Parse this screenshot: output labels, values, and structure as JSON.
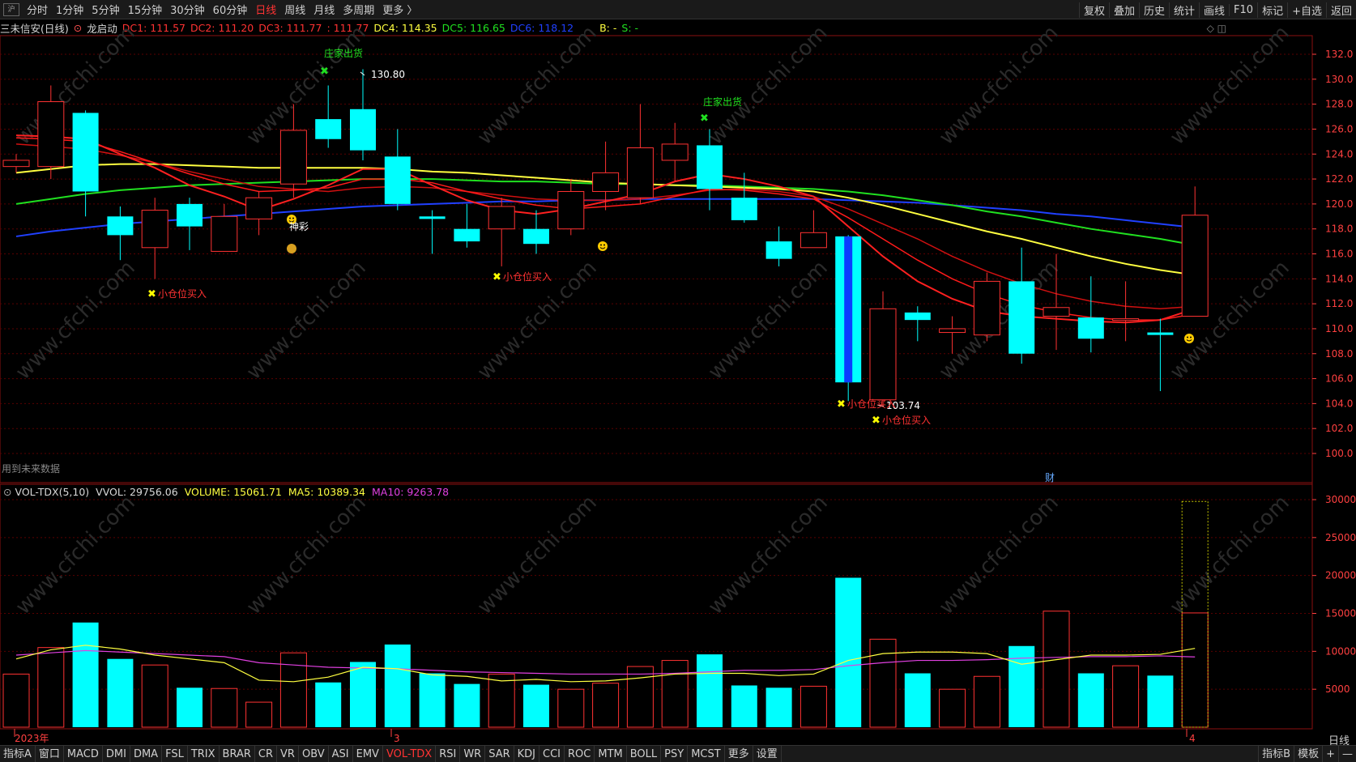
{
  "topbar": {
    "logo": "沪",
    "periods": [
      "分时",
      "1分钟",
      "5分钟",
      "15分钟",
      "30分钟",
      "60分钟",
      "日线",
      "周线",
      "月线",
      "多周期",
      "更多 〉"
    ],
    "active_period": "日线",
    "tools": [
      "复权",
      "叠加",
      "历史",
      "统计",
      "画线",
      "F10",
      "标记",
      "+自选",
      "返回"
    ]
  },
  "info": {
    "stock": "三未信安(日线)",
    "indicator": "龙启动",
    "dc1": "DC1: 111.57",
    "dc2": "DC2: 111.20",
    "dc3": "DC3: 111.77",
    "dc3b": ": 111.77",
    "dc4": "DC4: 114.35",
    "dc5": "DC5: 116.65",
    "dc6": "DC6: 118.12",
    "b": "B: -",
    "s": "S: -",
    "future": "用到未来数据"
  },
  "vol_info": {
    "name": "VOL-TDX(5,10)",
    "vvol": "VVOL: 29756.06",
    "volume": "VOLUME: 15061.71",
    "ma5": "MA5: 10389.34",
    "ma10": "MA10: 9263.78"
  },
  "colors": {
    "up": "#ff3232",
    "down": "#00ffff",
    "ma_red": "#ff2020",
    "ma_yellow": "#ffff40",
    "ma_green": "#20e020",
    "ma_blue": "#2040ff",
    "ma_magenta": "#e040e0",
    "axis": "#ff4040"
  },
  "chart_data": {
    "type": "candlestick",
    "price_ticks": [
      "132.0",
      "130.0",
      "128.0",
      "126.0",
      "124.0",
      "122.0",
      "120.0",
      "118.0",
      "116.0",
      "114.0",
      "112.0",
      "110.0",
      "108.0",
      "106.0",
      "104.0",
      "102.0",
      "100.0"
    ],
    "volume_ticks": [
      "30000",
      "25000",
      "20000",
      "15000",
      "10000",
      "5000"
    ],
    "date_labels": [
      "2023年",
      "3",
      "4"
    ],
    "annotations": {
      "sell1": "庄家出货",
      "sell2": "庄家出货",
      "buy1": "小仓位买入",
      "buy2": "小仓位买入",
      "buy3": "小仓位买入",
      "buy4": "小仓位买入",
      "shencai": "神彩",
      "high": "130.80",
      "low": "103.74",
      "cai": "财"
    },
    "candles": [
      {
        "o": 123.0,
        "h": 124.0,
        "l": 122.5,
        "c": 123.5,
        "v": 7000
      },
      {
        "o": 123.0,
        "h": 129.5,
        "l": 122.0,
        "c": 128.2,
        "v": 10500
      },
      {
        "o": 127.3,
        "h": 127.5,
        "l": 119.0,
        "c": 121.0,
        "v": 13800
      },
      {
        "o": 119.0,
        "h": 119.8,
        "l": 115.5,
        "c": 117.5,
        "v": 9000
      },
      {
        "o": 116.5,
        "h": 120.5,
        "l": 114.0,
        "c": 119.5,
        "v": 8200
      },
      {
        "o": 120.0,
        "h": 120.5,
        "l": 116.3,
        "c": 118.2,
        "v": 5200
      },
      {
        "o": 116.2,
        "h": 120.0,
        "l": 116.2,
        "c": 119.0,
        "v": 5100
      },
      {
        "o": 118.8,
        "h": 121.0,
        "l": 117.5,
        "c": 120.5,
        "v": 3300
      },
      {
        "o": 121.6,
        "h": 128.0,
        "l": 120.5,
        "c": 125.9,
        "v": 9800
      },
      {
        "o": 126.8,
        "h": 129.5,
        "l": 124.5,
        "c": 125.2,
        "v": 5900
      },
      {
        "o": 127.6,
        "h": 130.8,
        "l": 123.5,
        "c": 124.3,
        "v": 8600
      },
      {
        "o": 123.8,
        "h": 126.0,
        "l": 119.5,
        "c": 120.0,
        "v": 10900
      },
      {
        "o": 119.0,
        "h": 119.5,
        "l": 116.0,
        "c": 118.8,
        "v": 7100
      },
      {
        "o": 118.0,
        "h": 120.0,
        "l": 116.5,
        "c": 117.0,
        "v": 5700
      },
      {
        "o": 118.0,
        "h": 120.5,
        "l": 115.0,
        "c": 119.8,
        "v": 7000
      },
      {
        "o": 118.0,
        "h": 119.5,
        "l": 116.0,
        "c": 116.8,
        "v": 5600
      },
      {
        "o": 118.0,
        "h": 122.0,
        "l": 117.5,
        "c": 121.0,
        "v": 5000
      },
      {
        "o": 121.0,
        "h": 125.0,
        "l": 119.5,
        "c": 122.5,
        "v": 5800
      },
      {
        "o": 120.5,
        "h": 128.0,
        "l": 120.0,
        "c": 124.5,
        "v": 8000
      },
      {
        "o": 123.5,
        "h": 126.5,
        "l": 121.8,
        "c": 124.8,
        "v": 8800
      },
      {
        "o": 124.7,
        "h": 126.0,
        "l": 119.5,
        "c": 121.2,
        "v": 9600
      },
      {
        "o": 120.5,
        "h": 122.5,
        "l": 118.5,
        "c": 118.7,
        "v": 5500
      },
      {
        "o": 117.0,
        "h": 118.2,
        "l": 115.0,
        "c": 115.6,
        "v": 5200
      },
      {
        "o": 116.5,
        "h": 119.5,
        "l": 116.5,
        "c": 117.7,
        "v": 5400
      },
      {
        "o": 117.4,
        "h": 117.5,
        "l": 104.2,
        "c": 105.7,
        "v": 19700
      },
      {
        "o": 104.3,
        "h": 113.0,
        "l": 103.74,
        "c": 111.6,
        "v": 11600
      },
      {
        "o": 111.3,
        "h": 111.8,
        "l": 109.0,
        "c": 110.7,
        "v": 7100
      },
      {
        "o": 109.7,
        "h": 111.0,
        "l": 108.0,
        "c": 110.0,
        "v": 5000
      },
      {
        "o": 109.5,
        "h": 114.5,
        "l": 109.0,
        "c": 113.8,
        "v": 6700
      },
      {
        "o": 113.8,
        "h": 116.5,
        "l": 107.2,
        "c": 108.0,
        "v": 10700
      },
      {
        "o": 111.0,
        "h": 116.0,
        "l": 108.3,
        "c": 111.7,
        "v": 15300
      },
      {
        "o": 110.9,
        "h": 114.2,
        "l": 108.1,
        "c": 109.2,
        "v": 7100
      },
      {
        "o": 110.8,
        "h": 113.8,
        "l": 109.0,
        "c": 110.8,
        "v": 8100
      },
      {
        "o": 109.7,
        "h": 110.8,
        "l": 105.0,
        "c": 109.5,
        "v": 6800
      },
      {
        "o": 111.0,
        "h": 121.4,
        "l": 111.0,
        "c": 119.1,
        "v": 15061.71
      }
    ],
    "last_vvol": 29756.06,
    "ma_red1": [
      125.5,
      125.4,
      125.2,
      124.0,
      122.9,
      121.5,
      120.6,
      119.5,
      120.4,
      121.5,
      122.8,
      122.8,
      121.5,
      120.3,
      119.5,
      119.2,
      119.6,
      120.2,
      120.8,
      121.8,
      122.4,
      122.0,
      121.4,
      120.6,
      118.2,
      115.8,
      113.8,
      112.4,
      111.4,
      111.0,
      110.8,
      110.6,
      110.5,
      110.7,
      111.6
    ],
    "ma_red2": [
      125.3,
      125.2,
      125.0,
      124.2,
      123.3,
      122.4,
      121.6,
      121.0,
      121.1,
      121.3,
      122.0,
      122.0,
      121.7,
      121.0,
      120.4,
      119.9,
      119.6,
      119.8,
      120.0,
      120.6,
      121.2,
      121.1,
      120.8,
      120.4,
      118.9,
      117.2,
      115.5,
      114.0,
      112.8,
      111.9,
      111.3,
      110.9,
      110.7,
      110.7,
      111.2
    ],
    "ma_red3": [
      124.8,
      124.6,
      124.4,
      123.9,
      123.3,
      122.6,
      122.0,
      121.4,
      121.2,
      121.0,
      121.3,
      121.4,
      121.3,
      121.0,
      120.7,
      120.4,
      120.3,
      120.3,
      120.4,
      120.7,
      121.1,
      121.2,
      121.0,
      120.6,
      119.6,
      118.4,
      117.2,
      115.8,
      114.6,
      113.6,
      112.8,
      112.2,
      111.8,
      111.6,
      111.8
    ],
    "ma_yellow": [
      122.5,
      122.8,
      123.1,
      123.2,
      123.2,
      123.1,
      123.0,
      122.9,
      122.9,
      122.9,
      122.9,
      122.8,
      122.6,
      122.5,
      122.3,
      122.1,
      121.9,
      121.7,
      121.6,
      121.5,
      121.4,
      121.3,
      121.2,
      121.0,
      120.5,
      119.9,
      119.2,
      118.5,
      117.8,
      117.2,
      116.5,
      115.8,
      115.2,
      114.7,
      114.3
    ],
    "ma_green": [
      120.0,
      120.4,
      120.8,
      121.1,
      121.3,
      121.5,
      121.6,
      121.7,
      121.8,
      121.9,
      122.0,
      122.0,
      122.0,
      121.9,
      121.8,
      121.8,
      121.7,
      121.6,
      121.6,
      121.5,
      121.5,
      121.4,
      121.3,
      121.2,
      121.0,
      120.7,
      120.3,
      119.9,
      119.4,
      119.0,
      118.5,
      118.0,
      117.6,
      117.2,
      116.7
    ],
    "ma_blue": [
      117.4,
      117.8,
      118.1,
      118.4,
      118.6,
      118.8,
      119.0,
      119.2,
      119.4,
      119.6,
      119.8,
      119.9,
      120.0,
      120.1,
      120.2,
      120.2,
      120.3,
      120.3,
      120.4,
      120.4,
      120.4,
      120.4,
      120.4,
      120.4,
      120.3,
      120.2,
      120.1,
      119.9,
      119.7,
      119.5,
      119.2,
      119.0,
      118.7,
      118.4,
      118.1
    ],
    "vol_ma5": [
      9000,
      10200,
      10800,
      10300,
      9500,
      9000,
      8500,
      6200,
      6000,
      6600,
      7900,
      7700,
      6900,
      6700,
      6100,
      6300,
      6000,
      6100,
      6500,
      7000,
      7100,
      7100,
      6800,
      7000,
      8800,
      9700,
      9900,
      9900,
      9700,
      8300,
      8900,
      9500,
      9500,
      9600,
      10389
    ],
    "vol_ma10": [
      9500,
      9800,
      10100,
      9900,
      9700,
      9500,
      9300,
      8500,
      8200,
      7900,
      7800,
      7700,
      7500,
      7300,
      7200,
      7100,
      7000,
      7000,
      7000,
      7100,
      7300,
      7500,
      7500,
      7600,
      8100,
      8500,
      8800,
      8800,
      8900,
      9100,
      9200,
      9300,
      9300,
      9400,
      9264
    ]
  },
  "bottom": {
    "tabs": [
      "指标A",
      "窗口",
      "MACD",
      "DMI",
      "DMA",
      "FSL",
      "TRIX",
      "BRAR",
      "CR",
      "VR",
      "OBV",
      "ASI",
      "EMV",
      "VOL-TDX",
      "RSI",
      "WR",
      "SAR",
      "KDJ",
      "CCI",
      "ROC",
      "MTM",
      "BOLL",
      "PSY",
      "MCST",
      "更多",
      "设置"
    ],
    "active": "VOL-TDX",
    "right": [
      "指标B",
      "模板",
      "+",
      "—"
    ],
    "daily": "日线"
  }
}
